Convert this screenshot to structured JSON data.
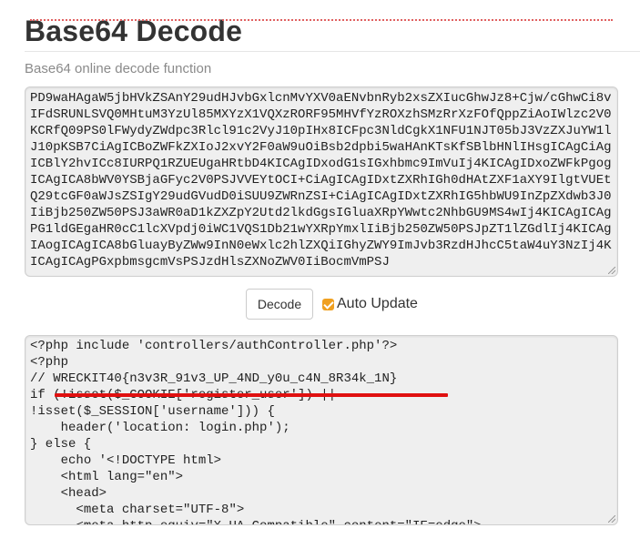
{
  "header": {
    "title": "Base64 Decode",
    "subtitle": "Base64 online decode function"
  },
  "input": {
    "text": "PD9waHAgaW5jbHVkZSAnY29udHJvbGxlcnMvYXV0aENvbnRyb2xsZXIucGhwJz8+Cjw/cGhwCi8vIFdSRUNLSVQ0MHtuM3YzUl85MXYzX1VQXzRORF95MHVfYzROXzhSMzRrXzFOfQppZiAoIWlzc2V0KCRfQ09PS0lFWydyZWdpc3Rlcl91c2VyJ10pIHx8ICFpc3NldCgkX1NFU1NJT05bJ3VzZXJuYW1lJ10pKSB7CiAgICBoZWFkZXIoJ2xvY2F0aW9uOiBsb2dpbi5waHAnKTsKfSBlbHNlIHsgICAgCiAgICBlY2hvICc8IURPQ1RZUEUgaHRtbD4KICAgIDxodG1sIGxhbmc9ImVuIj4KICAgIDxoZWFkPgogICAgICA8bWV0YSBjaGFyc2V0PSJVVEYtOCI+CiAgICAgIDxtZXRhIGh0dHAtZXF1aXY9IlgtVUEtQ29tcGF0aWJsZSIgY29udGVudD0iSUU9ZWRnZSI+CiAgICAgIDxtZXRhIG5hbWU9InZpZXdwb3J0IiBjb250ZW50PSJ3aWR0aD1kZXZpY2Utd2lkdGgsIGluaXRpYWwtc2NhbGU9MS4wIj4KICAgICAgPG1ldGEgaHR0cC1lcXVpdj0iWC1VQS1Db21wYXRpYmxlIiBjb250ZW50PSJpZT1lZGdlIj4KICAgIAogICAgICA8bGluayByZWw9InN0eWxlc2hlZXQiIGhyZWY9ImJvb3RzdHJhcC5taW4uY3NzIj4KICAgICAgPGxpbmsgcmVsPSJzdHlsZXNoZWV0IiBocmVmPSJ"
  },
  "controls": {
    "decode_label": "Decode",
    "auto_update_label": "Auto Update",
    "auto_update_checked": true
  },
  "output": {
    "text": "<?php include 'controllers/authController.php'?>\n<?php\n// WRECKIT40{n3v3R_91v3_UP_4ND_y0u_c4N_8R34k_1N}\nif (!isset($_COOKIE['register_user']) ||\n!isset($_SESSION['username'])) {\n    header('location: login.php');\n} else {\n    echo '<!DOCTYPE html>\n    <html lang=\"en\">\n    <head>\n      <meta charset=\"UTF-8\">\n      <meta http-equiv=\"X-UA-Compatible\" content=\"IE=edge\">"
  },
  "colors": {
    "highlight_underline": "#e01010",
    "checkbox_accent": "#f0a020"
  }
}
